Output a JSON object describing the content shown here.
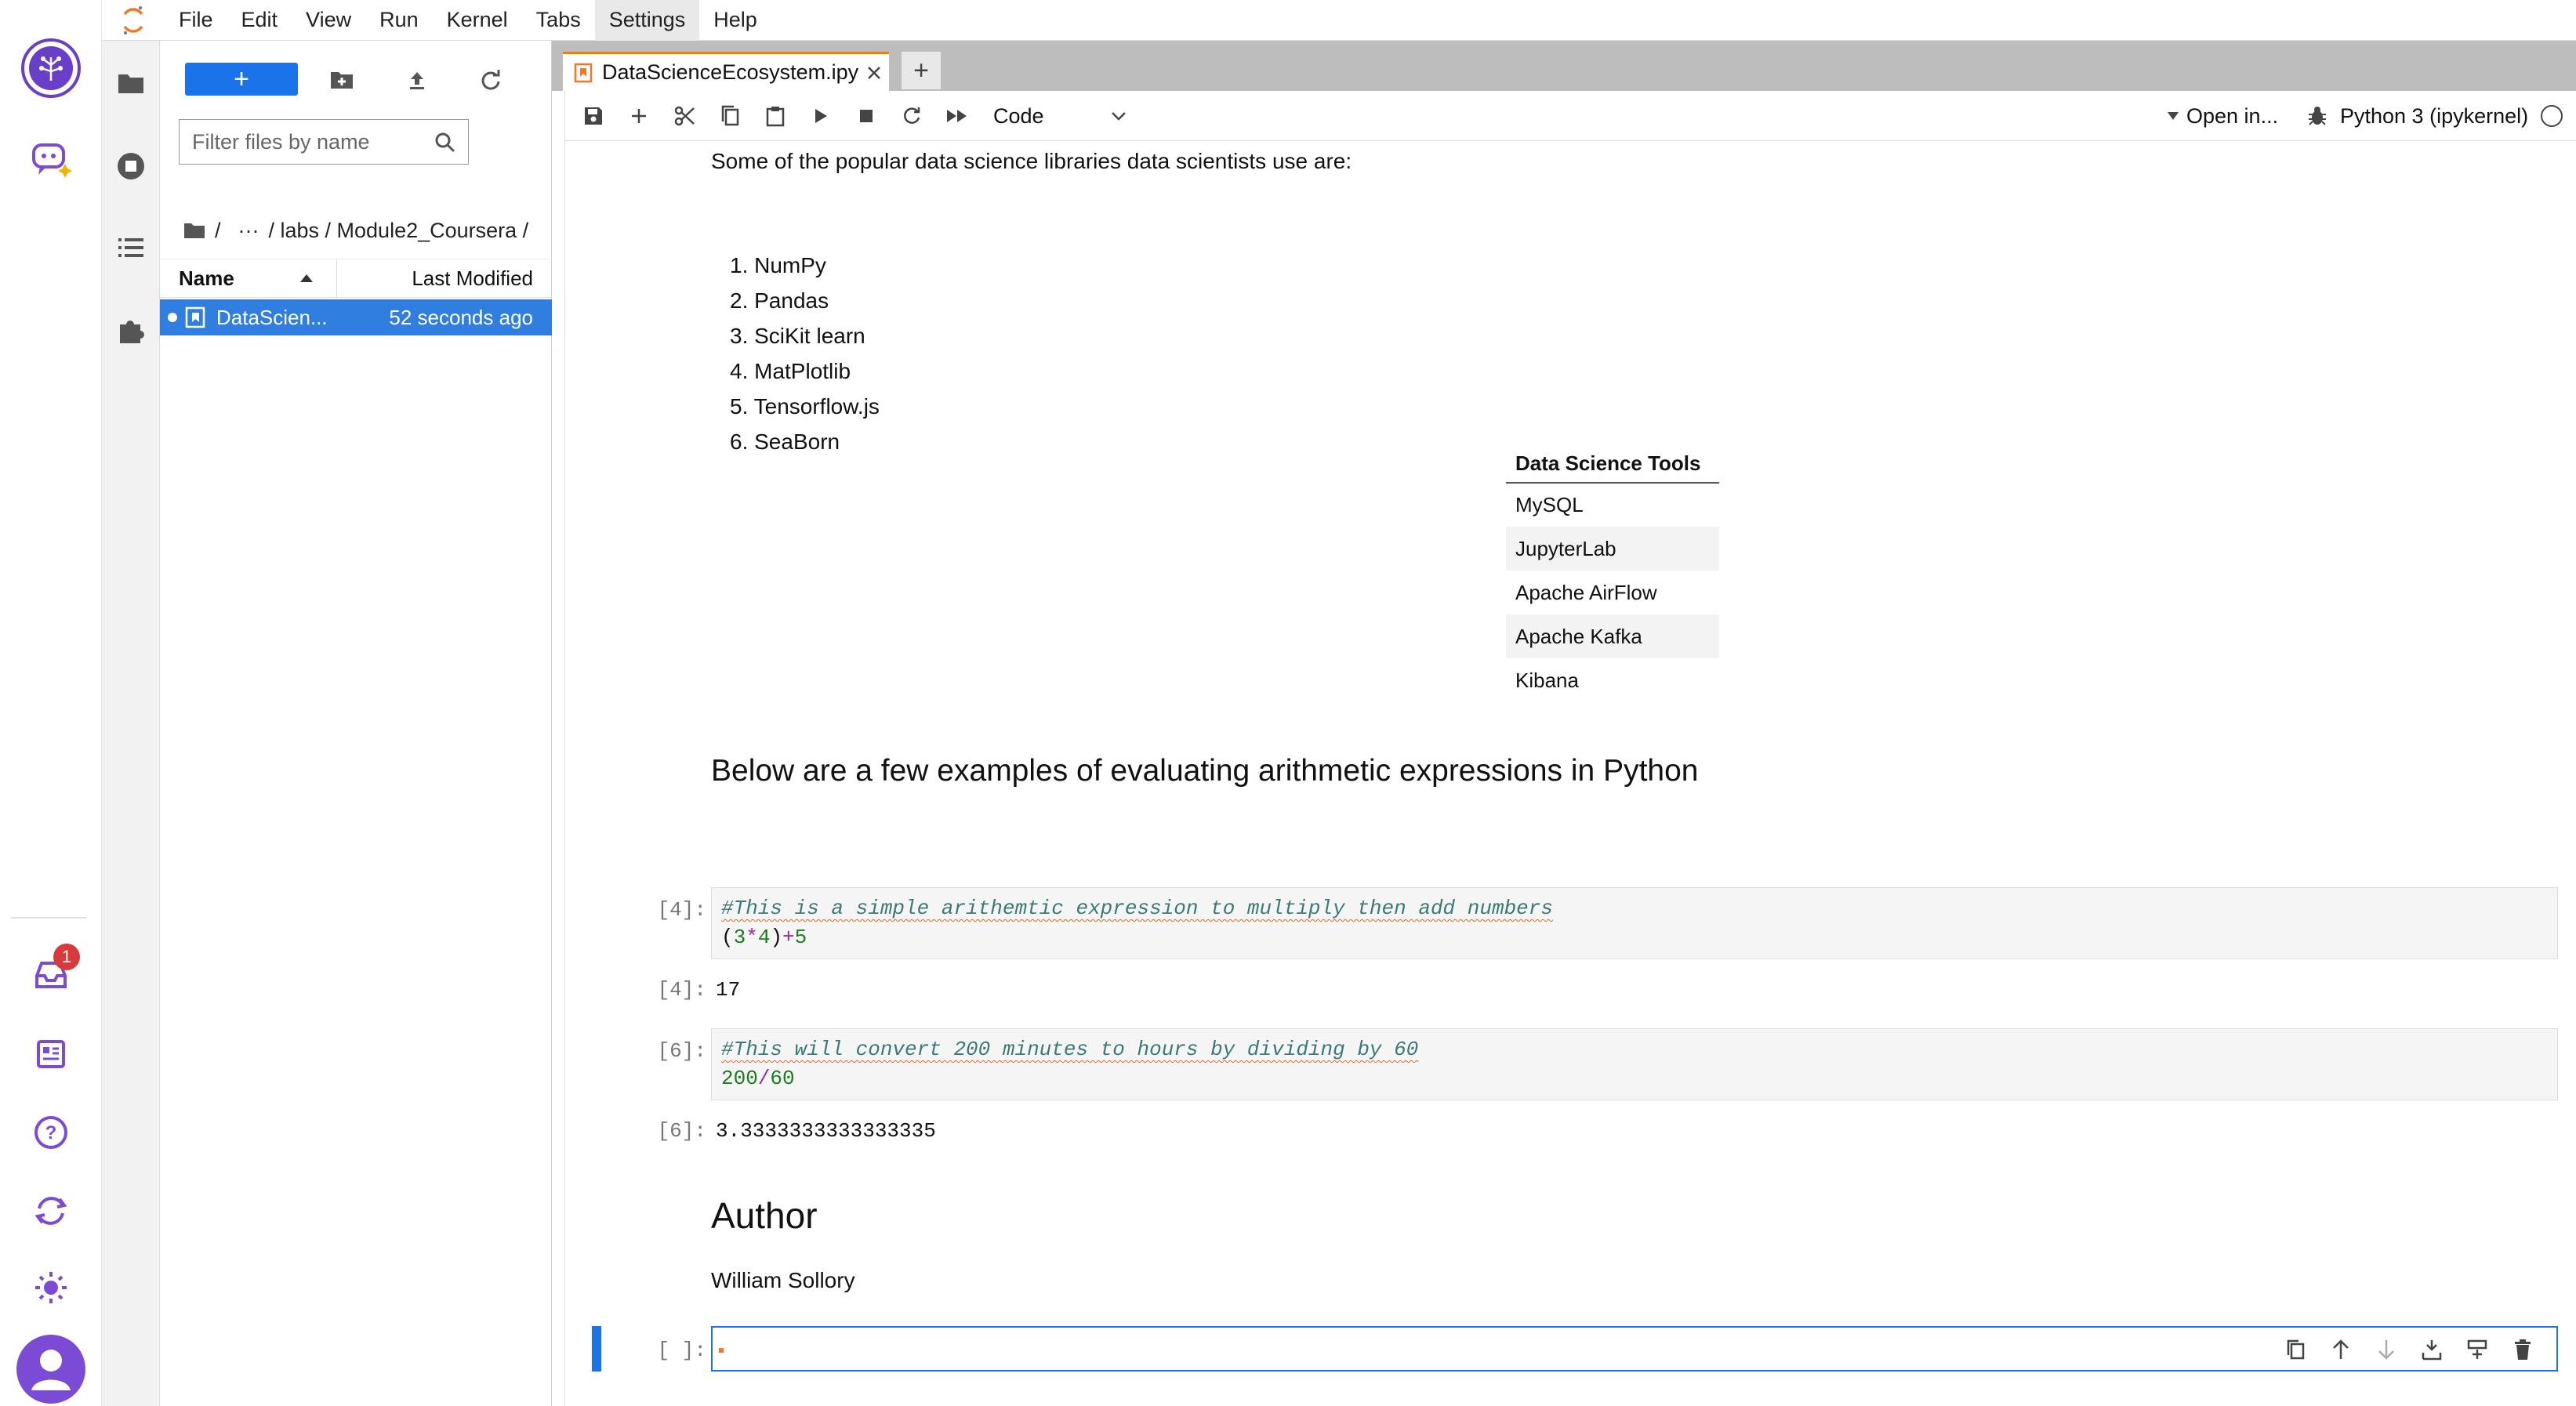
{
  "menu": [
    "File",
    "Edit",
    "View",
    "Run",
    "Kernel",
    "Tabs",
    "Settings",
    "Help"
  ],
  "menu_active": "Settings",
  "dock": {
    "notification_count": "1"
  },
  "filebrowser": {
    "new_label": "+",
    "filter_placeholder": "Filter files by name",
    "breadcrumb": {
      "root": "/",
      "ellipsis": "···",
      "path": "/ labs / Module2_Coursera /"
    },
    "col_name": "Name",
    "col_modified": "Last Modified",
    "files": [
      {
        "name": "DataScien...",
        "modified": "52 seconds ago"
      }
    ]
  },
  "notebook": {
    "tab_title": "DataScienceEcosystem.ipy",
    "cell_type": "Code",
    "open_in": "Open in...",
    "kernel": "Python 3 (ipykernel)",
    "intro": "Some of the popular data science libraries data scientists use are:",
    "libraries": [
      "1. NumPy",
      "2. Pandas",
      "3. SciKit learn",
      "4. MatPlotlib",
      "5. Tensorflow.js",
      "6. SeaBorn"
    ],
    "tools_header": "Data Science Tools",
    "tools": [
      "MySQL",
      "JupyterLab",
      "Apache AirFlow",
      "Apache Kafka",
      "Kibana"
    ],
    "arith_heading": "Below are a few examples of evaluating arithmetic expressions in Python",
    "cells": [
      {
        "prompt": "[4]:",
        "comment": "#This is a simple arithemtic expression to multiply then add numbers",
        "code": {
          "p1": "(",
          "n1": "3",
          "o1": "*",
          "n2": "4",
          "p2": ")",
          "o2": "+",
          "n3": "5"
        },
        "out_prompt": "[4]:",
        "output": "17"
      },
      {
        "prompt": "[6]:",
        "comment": "#This will convert 200 minutes to hours by dividing by 60",
        "code": {
          "n1": "200",
          "o1": "/",
          "n2": "60"
        },
        "out_prompt": "[6]:",
        "output": "3.3333333333333335"
      }
    ],
    "author_heading": "Author",
    "author_name": "William Sollory",
    "empty_prompt": "[ ]:"
  },
  "colors": {
    "accent": "#1a73e8",
    "brand": "#ff7a00",
    "dock_icon": "#7b4bd6"
  }
}
